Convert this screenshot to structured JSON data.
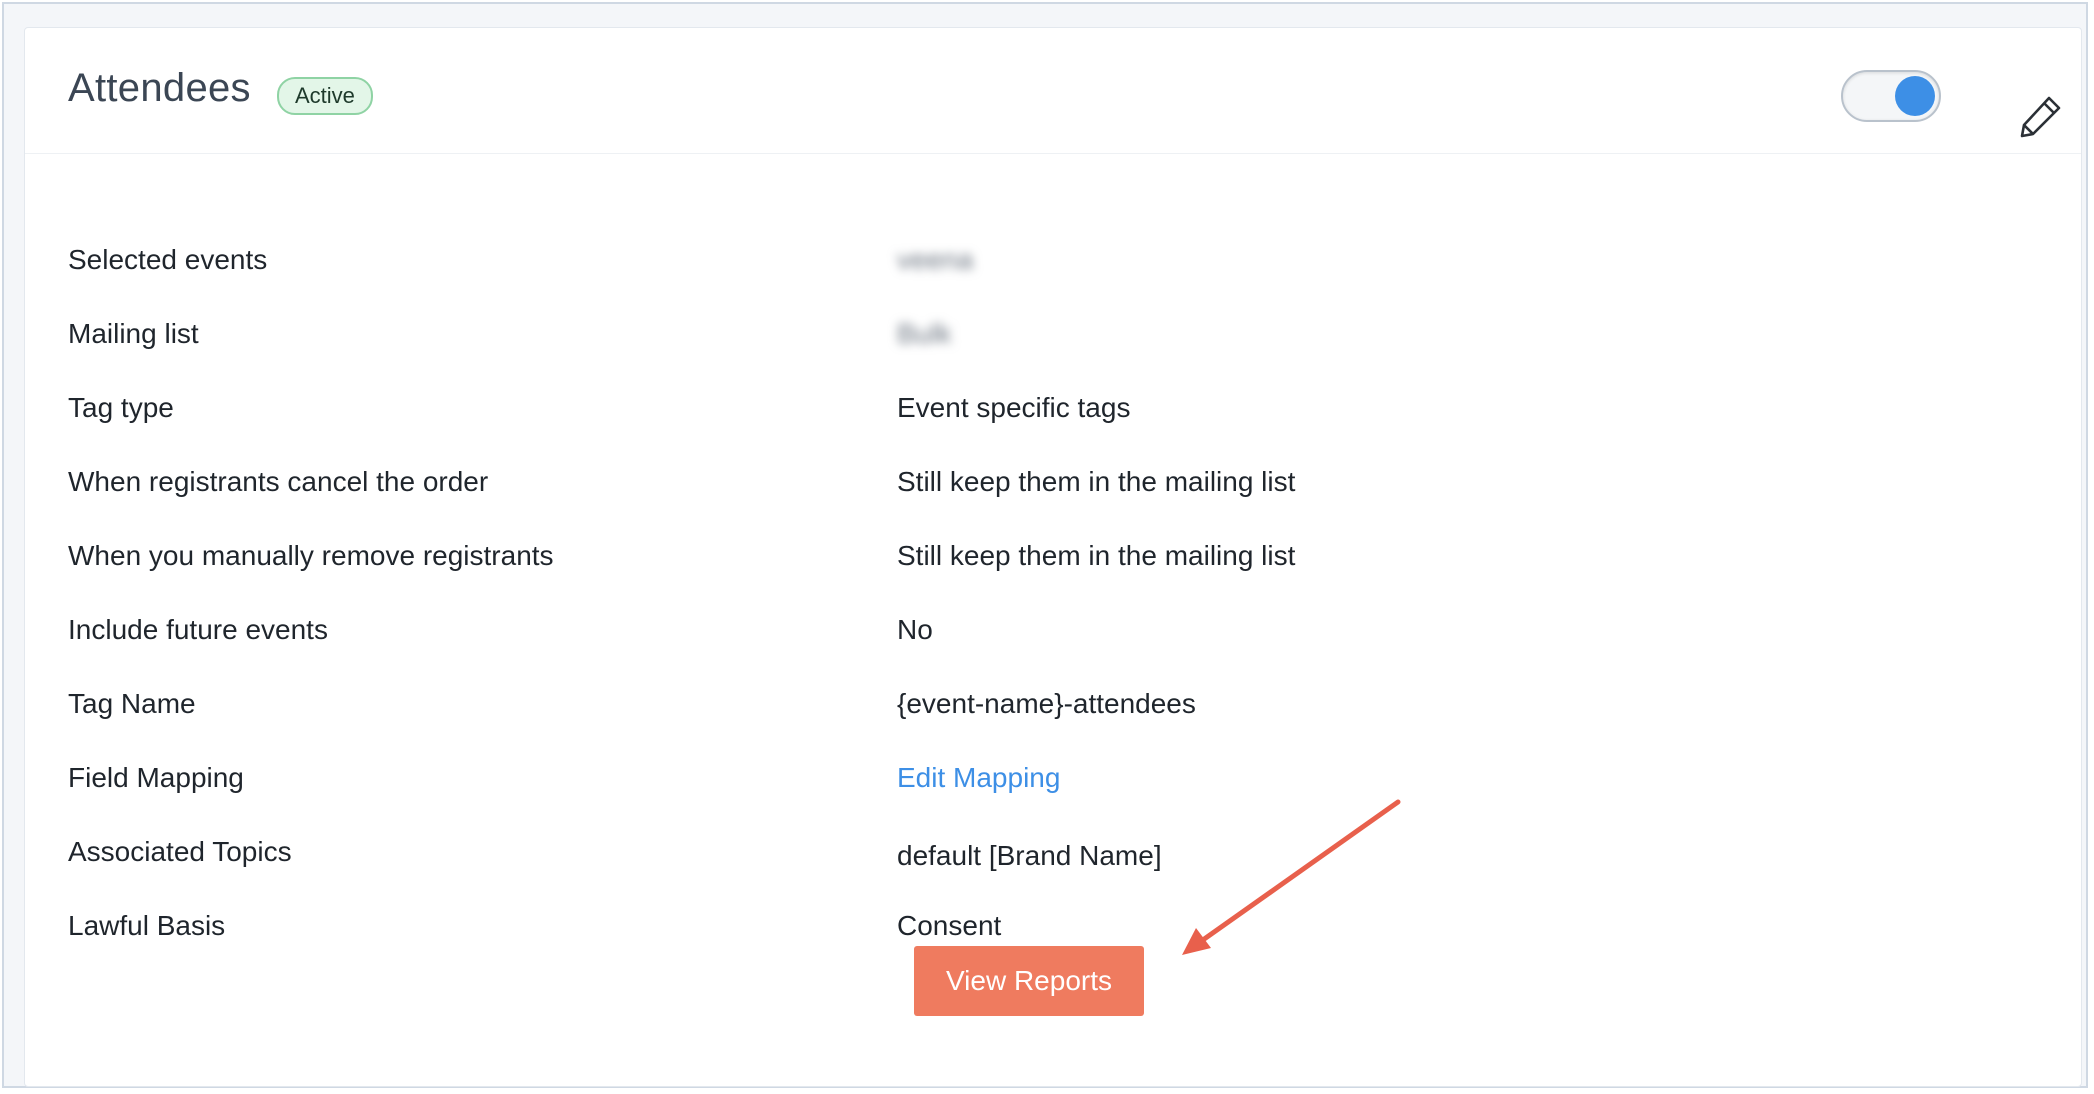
{
  "header": {
    "title": "Attendees",
    "status_badge": "Active",
    "toggle_on": true
  },
  "details": [
    {
      "label": "Selected events",
      "value": "veena",
      "blurred": true
    },
    {
      "label": "Mailing list",
      "value": "Bulk",
      "blurred": true
    },
    {
      "label": "Tag type",
      "value": "Event specific tags"
    },
    {
      "label": "When registrants cancel the order",
      "value": "Still keep them in the mailing list"
    },
    {
      "label": "When you manually remove registrants",
      "value": "Still keep them in the mailing list"
    },
    {
      "label": "Include future events",
      "value": "No"
    },
    {
      "label": "Tag Name",
      "value": "{event-name}-attendees"
    },
    {
      "label": "Field Mapping",
      "value": "Edit Mapping",
      "link": true
    },
    {
      "label": "Associated Topics",
      "value": "default [Brand Name]"
    },
    {
      "label": "Lawful Basis",
      "value": "Consent"
    }
  ],
  "actions": {
    "view_reports_label": "View Reports"
  },
  "colors": {
    "accent_blue": "#3d8fe6",
    "button_orange": "#ef7b5f",
    "annotation_arrow": "#e8604c",
    "badge_bg": "#e3f6e8",
    "badge_border": "#8fd3a4"
  }
}
